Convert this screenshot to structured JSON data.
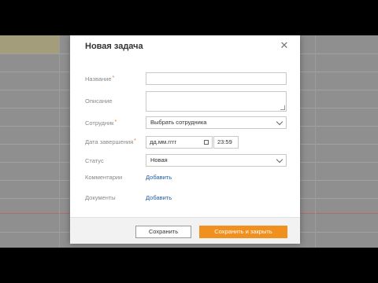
{
  "dialog": {
    "title": "Новая задача",
    "close_icon": "close-icon"
  },
  "form": {
    "name_label": "Название",
    "name_value": "",
    "description_label": "Описание",
    "employee_label": "Сотрудник",
    "employee_value": "Выбрать сотрудника",
    "close_date_label": "Дата завершения",
    "date_placeholder": "дд.мм.гггг",
    "time_value": "23:59",
    "status_label": "Статус",
    "status_value": "Новая",
    "comments_label": "Комментарии",
    "comments_link": "Добавить",
    "documents_label": "Документы",
    "documents_link": "Добавить",
    "required_mark": "*"
  },
  "footer": {
    "save_label": "Сохранить",
    "save_close_label": "Сохранить и закрыть"
  },
  "colors": {
    "accent": "#f0901e",
    "link": "#1d5fa8",
    "required": "#e07b2a"
  }
}
